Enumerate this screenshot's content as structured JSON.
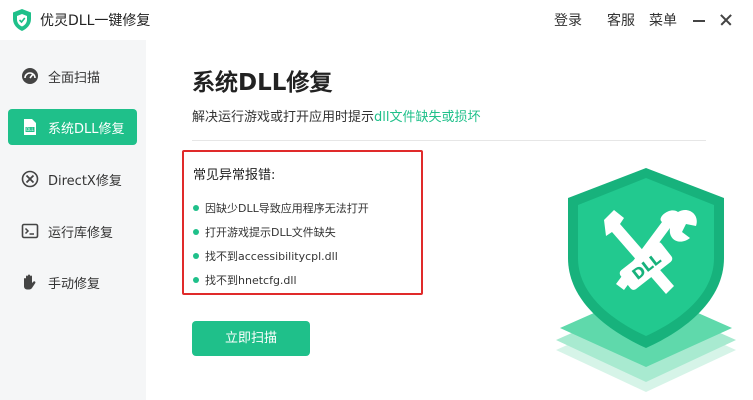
{
  "app": {
    "title": "优灵DLL一键修复"
  },
  "topbar": {
    "login_label": "登录",
    "service_label": "客服",
    "menu_label": "菜单"
  },
  "sidebar": {
    "items": [
      {
        "label": "全面扫描",
        "icon": "scan-icon",
        "active": false
      },
      {
        "label": "系统DLL修复",
        "icon": "dll-file-icon",
        "active": true
      },
      {
        "label": "DirectX修复",
        "icon": "directx-icon",
        "active": false
      },
      {
        "label": "运行库修复",
        "icon": "runtime-icon",
        "active": false
      },
      {
        "label": "手动修复",
        "icon": "manual-fix-icon",
        "active": false
      }
    ]
  },
  "main": {
    "title": "系统DLL修复",
    "subtitle_prefix": "解决运行游戏或打开应用时提示",
    "subtitle_highlight": "dll文件缺失或损坏",
    "errors": {
      "heading": "常见异常报错:",
      "items": [
        "因缺少DLL导致应用程序无法打开",
        "打开游戏提示DLL文件缺失",
        "找不到accessibilitycpl.dll",
        "找不到hnetcfg.dll"
      ]
    },
    "scan_button_label": "立即扫描",
    "illustration_label": "DLL"
  },
  "colors": {
    "accent": "#1fc08a",
    "error_border": "#e02a2a",
    "sidebar_bg": "#f5f6f7"
  }
}
